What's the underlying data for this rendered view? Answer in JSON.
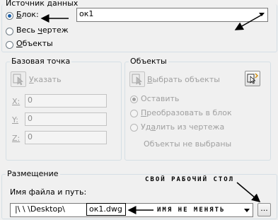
{
  "source": {
    "title": "Источник данных",
    "block_label": "Блок:",
    "block_underline": "Б",
    "block_rest": "лок:",
    "whole_label_pre": "Весь ",
    "whole_label_u": "ч",
    "whole_label_post": "ертеж",
    "objects_label_u": "О",
    "objects_label_post": "бъекты",
    "block_combo_value": "ок1",
    "selected": "block"
  },
  "base_point": {
    "title": "Базовая точка",
    "pick_label_u": "У",
    "pick_label_post": "казать",
    "x_label": "X:",
    "y_label": "Y:",
    "z_label": "Z:",
    "x_value": "0",
    "y_value": "0",
    "z_value": "0"
  },
  "objects": {
    "title": "Объекты",
    "select_label_u": "В",
    "select_label_post": "ыбрать объекты",
    "keep_label": "Оставить",
    "convert_label_u": "П",
    "convert_label_post": "реобразовать в блок",
    "delete_label_pre": "Уд",
    "delete_label_u": "а",
    "delete_label_post": "лить из чертежа",
    "status": "Объекты не выбраны",
    "selected": "keep"
  },
  "placement": {
    "title": "Размещение",
    "path_label": "Имя файла и путь:",
    "path_prefix": "|\\     \\      \\Desktop\\",
    "path_file": "ок1.dwg",
    "browse_label": "..."
  },
  "annotations": {
    "desktop": "СВОЙ РАБОЧИЙ СТОЛ",
    "name": "ИМЯ НЕ МЕНЯТЬ"
  }
}
